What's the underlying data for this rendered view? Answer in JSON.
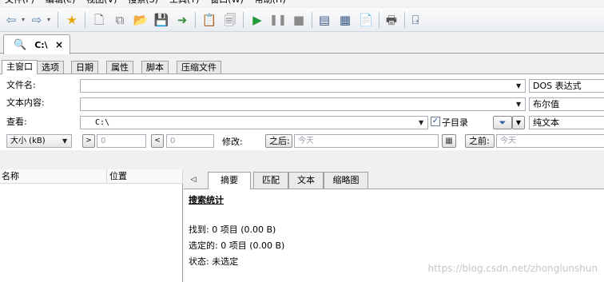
{
  "menubar": {
    "items": [
      "文件(F)",
      "编辑(e)",
      "视图(V)",
      "搜索(S)",
      "工具(T)",
      "窗口(W)",
      "帮助(H)"
    ]
  },
  "toolbar": {
    "icons": [
      "back-icon",
      "forward-icon",
      "favorites-icon",
      "new-icon",
      "copy-icon",
      "open-folder-icon",
      "save-icon",
      "export-icon",
      "clipboard-icon",
      "search-file-icon",
      "start-icon",
      "pause-icon",
      "stop-icon",
      "properties-icon",
      "layout-icon",
      "report-icon",
      "print-icon",
      "exit-icon"
    ]
  },
  "doc_tab": {
    "title": "C:\\",
    "close": "×"
  },
  "search_tabs": [
    "主窗口",
    "选项",
    "日期",
    "属性",
    "脚本",
    "压缩文件"
  ],
  "search_form": {
    "filename_label": "文件名:",
    "filename_value": "",
    "filename_mode": "DOS 表达式",
    "content_label": "文本内容:",
    "content_value": "",
    "content_mode": "布尔值",
    "lookin_label": "查看:",
    "lookin_value": "C:\\",
    "subdirs_label": "子目录",
    "subdirs_checked": true,
    "text_mode": "纯文本",
    "size_select": "大小 (kB)",
    "size_gt_button": ">",
    "size_gt_value": "0",
    "size_lt_button": "<",
    "size_lt_value": "0",
    "modified_label": "修改:",
    "after_button": "之后:",
    "after_placeholder": "今天",
    "before_button": "之前:",
    "before_placeholder": "今天"
  },
  "results": {
    "columns": [
      "名称",
      "位置"
    ]
  },
  "detail_tabs": [
    "摘要",
    "匹配",
    "文本",
    "缩略图"
  ],
  "summary": {
    "heading": "搜索统计",
    "found": "找到: 0 项目 (0.00 B)",
    "selected": "选定的: 0 项目 (0.00 B)",
    "status": "状态: 未选定"
  },
  "watermark": "https://blog.csdn.net/zhonglunshun"
}
